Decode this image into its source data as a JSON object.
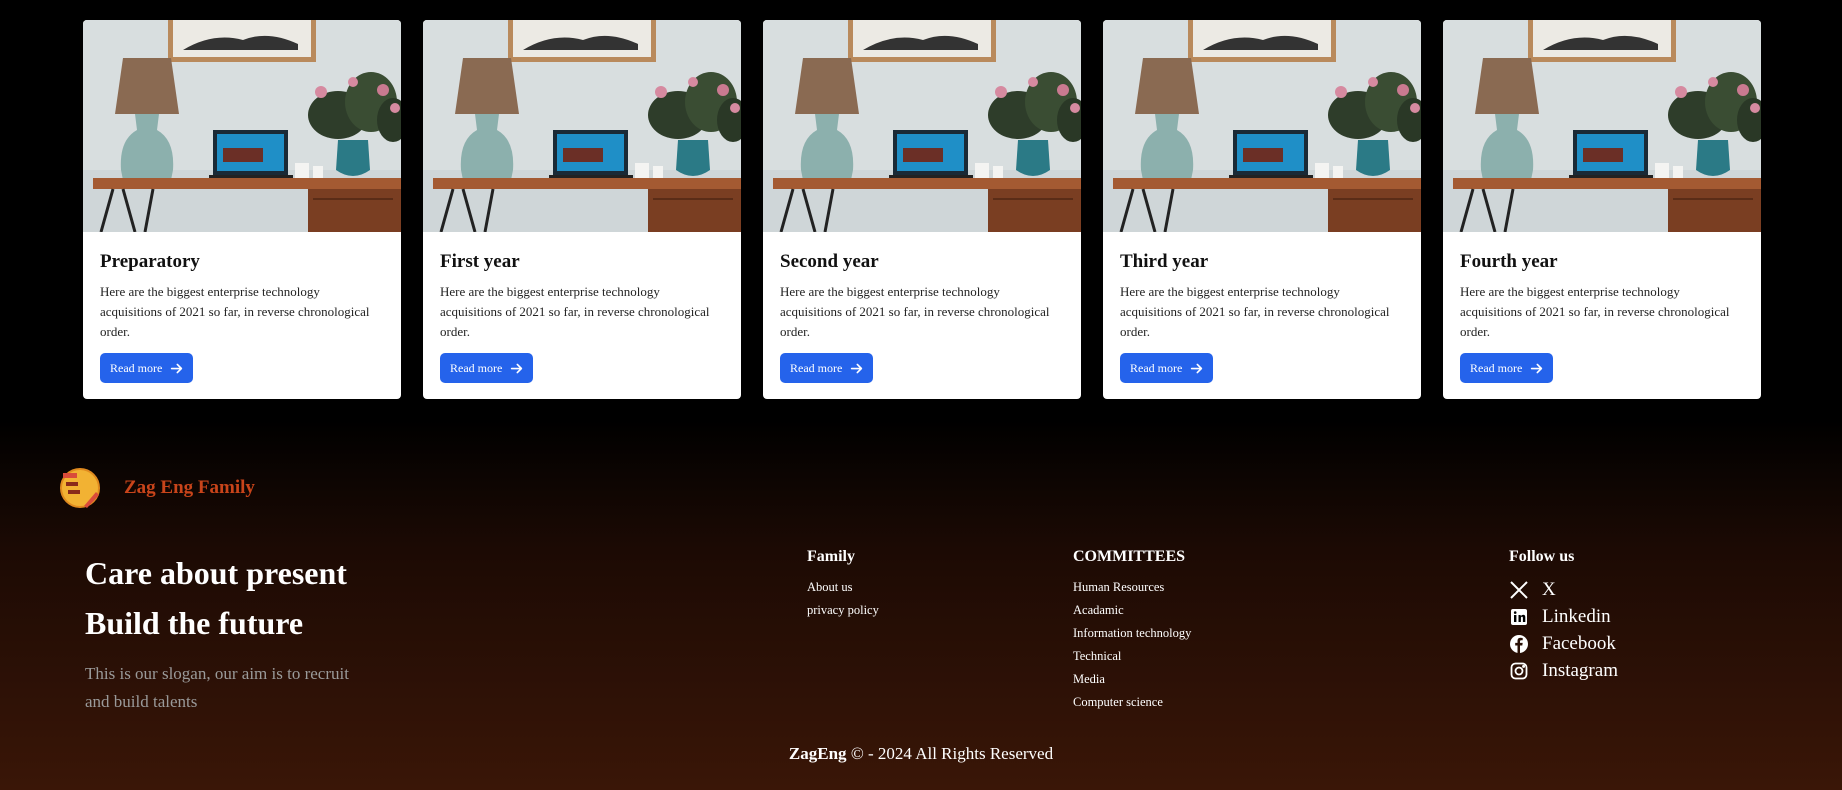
{
  "cards": [
    {
      "title": "Preparatory",
      "text": "Here are the biggest enterprise technology acquisitions of 2021 so far, in reverse chronological order.",
      "button": "Read more"
    },
    {
      "title": "First year",
      "text": "Here are the biggest enterprise technology acquisitions of 2021 so far, in reverse chronological order.",
      "button": "Read more"
    },
    {
      "title": "Second year",
      "text": "Here are the biggest enterprise technology acquisitions of 2021 so far, in reverse chronological order.",
      "button": "Read more"
    },
    {
      "title": "Third year",
      "text": "Here are the biggest enterprise technology acquisitions of 2021 so far, in reverse chronological order.",
      "button": "Read more"
    },
    {
      "title": "Fourth year",
      "text": "Here are the biggest enterprise technology acquisitions of 2021 so far, in reverse chronological order.",
      "button": "Read more"
    }
  ],
  "footer": {
    "brand": {
      "name": "Zag Eng Family",
      "color": "#c8441a"
    },
    "tagline": [
      "Care about present",
      "Build the future"
    ],
    "slogan": "This is our slogan, our aim is to recruit and build talents",
    "family": {
      "title": "Family",
      "links": [
        "About us",
        "privacy policy"
      ]
    },
    "committees": {
      "title": "COMMITTEES",
      "links": [
        "Human Resources",
        "Acadamic",
        "Information technology",
        "Technical",
        "Media",
        "Computer science"
      ]
    },
    "follow": {
      "title": "Follow us",
      "links": [
        {
          "label": "X",
          "icon": "x-icon"
        },
        {
          "label": "Linkedin",
          "icon": "linkedin-icon"
        },
        {
          "label": "Facebook",
          "icon": "facebook-icon"
        },
        {
          "label": "Instagram",
          "icon": "instagram-icon"
        }
      ]
    },
    "copyright": {
      "brand": "ZagEng",
      "text": " © - 2024 All Rights Reserved"
    }
  },
  "colors": {
    "button": "#2563eb",
    "background": "#000000"
  }
}
